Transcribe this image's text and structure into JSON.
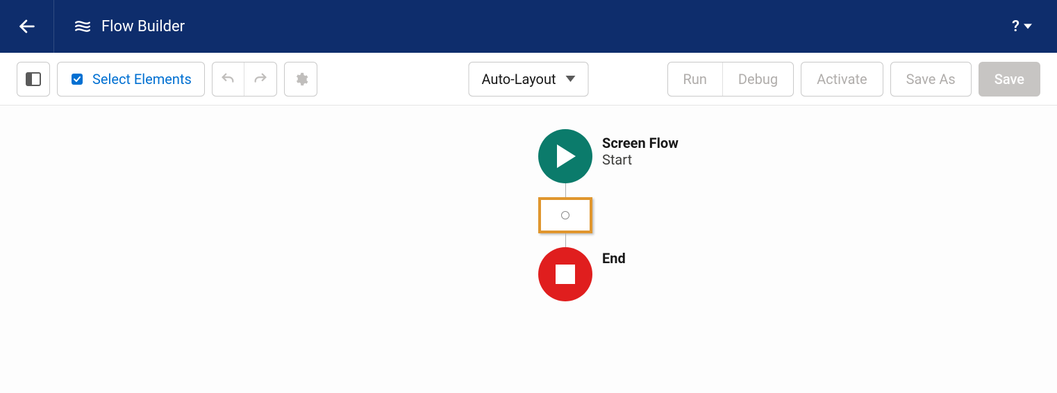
{
  "header": {
    "title": "Flow Builder"
  },
  "toolbar": {
    "select_elements_label": "Select Elements",
    "layout_mode": "Auto-Layout",
    "run_label": "Run",
    "debug_label": "Debug",
    "activate_label": "Activate",
    "save_as_label": "Save As",
    "save_label": "Save"
  },
  "canvas": {
    "start_node": {
      "title": "Screen Flow",
      "subtitle": "Start"
    },
    "end_node": {
      "title": "End"
    }
  }
}
